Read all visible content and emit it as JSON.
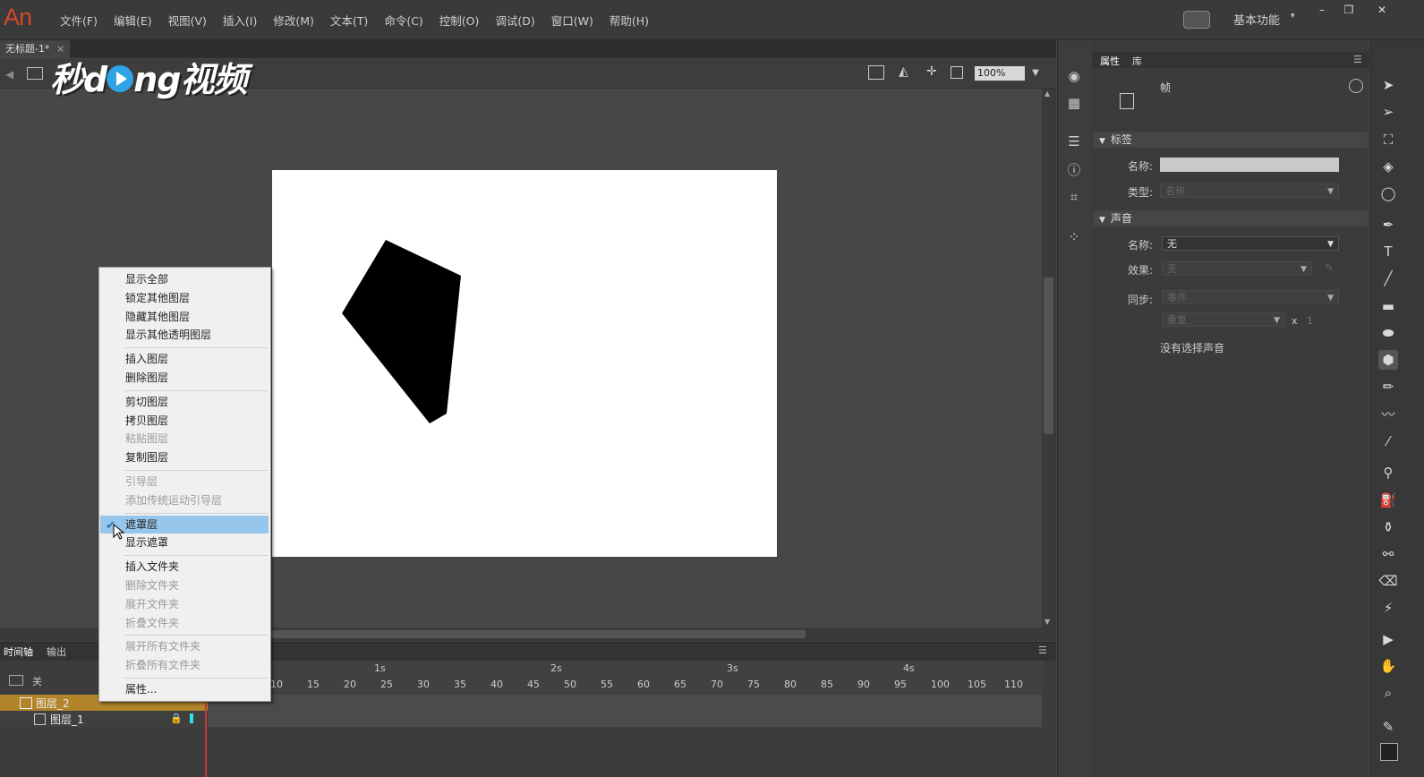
{
  "app": {
    "logo": "An",
    "workspace": "基本功能"
  },
  "menu": [
    "文件(F)",
    "编辑(E)",
    "视图(V)",
    "插入(I)",
    "修改(M)",
    "文本(T)",
    "命令(C)",
    "控制(O)",
    "调试(D)",
    "窗口(W)",
    "帮助(H)"
  ],
  "window_buttons": {
    "minimize": "–",
    "restore": "❐",
    "close": "✕"
  },
  "document": {
    "tab_title": "无标题-1*",
    "tab_close": "×",
    "zoom": "100%"
  },
  "watermark": {
    "before": "秒d",
    "after": "ng视频"
  },
  "timeline": {
    "tabs": [
      "时间轴",
      "输出"
    ],
    "header_label": "关",
    "seconds": [
      "1s",
      "2s",
      "3s",
      "4s"
    ],
    "frame_numbers": [
      "10",
      "15",
      "20",
      "25",
      "30",
      "35",
      "40",
      "45",
      "50",
      "55",
      "60",
      "65",
      "70",
      "75",
      "80",
      "85",
      "90",
      "95",
      "100",
      "105",
      "110"
    ],
    "layers": [
      {
        "name": "图层_2",
        "selected": true
      },
      {
        "name": "图层_1",
        "selected": false
      }
    ]
  },
  "properties": {
    "tabs": [
      "属性",
      "库"
    ],
    "object_type": "帧",
    "label_section": {
      "title": "标签",
      "name_label": "名称:",
      "name_value": "",
      "type_label": "类型:",
      "type_value": "名称"
    },
    "sound_section": {
      "title": "声音",
      "name_label": "名称:",
      "name_value": "无",
      "effect_label": "效果:",
      "effect_value": "无",
      "sync_label": "同步:",
      "sync_value": "事件",
      "repeat_value": "重复",
      "times_label": "x",
      "times_value": "1",
      "no_sound_text": "没有选择声音"
    }
  },
  "context_menu": {
    "items": [
      {
        "label": "显示全部",
        "enabled": true
      },
      {
        "label": "锁定其他图层",
        "enabled": true
      },
      {
        "label": "隐藏其他图层",
        "enabled": true
      },
      {
        "label": "显示其他透明图层",
        "enabled": true
      },
      {
        "label": "插入图层",
        "enabled": true
      },
      {
        "label": "删除图层",
        "enabled": true
      },
      {
        "label": "剪切图层",
        "enabled": true
      },
      {
        "label": "拷贝图层",
        "enabled": true
      },
      {
        "label": "粘贴图层",
        "enabled": false
      },
      {
        "label": "复制图层",
        "enabled": true
      },
      {
        "label": "引导层",
        "enabled": false
      },
      {
        "label": "添加传统运动引导层",
        "enabled": false
      },
      {
        "label": "遮罩层",
        "enabled": true,
        "checked": true,
        "highlighted": true
      },
      {
        "label": "显示遮罩",
        "enabled": true
      },
      {
        "label": "插入文件夹",
        "enabled": true
      },
      {
        "label": "删除文件夹",
        "enabled": false
      },
      {
        "label": "展开文件夹",
        "enabled": false
      },
      {
        "label": "折叠文件夹",
        "enabled": false
      },
      {
        "label": "展开所有文件夹",
        "enabled": false
      },
      {
        "label": "折叠所有文件夹",
        "enabled": false
      },
      {
        "label": "属性...",
        "enabled": true
      }
    ],
    "check_mark": "✔"
  },
  "colors": {
    "accent": "#97c6ec",
    "layer_selected": "#b1842a",
    "logo": "#d04a2a",
    "shape_fill": "#000000"
  }
}
